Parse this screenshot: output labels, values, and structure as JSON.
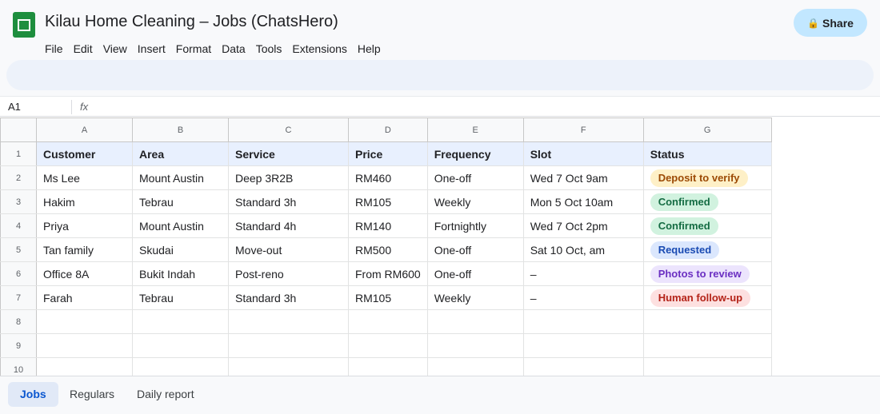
{
  "app": {
    "title": "Kilau Home Cleaning – Jobs (ChatsHero)",
    "share_label": "Share",
    "share_icon": "lock-icon",
    "brand_color": "#1e8e3e"
  },
  "menu": [
    "File",
    "Edit",
    "View",
    "Insert",
    "Format",
    "Data",
    "Tools",
    "Extensions",
    "Help"
  ],
  "formula_bar": {
    "cell_ref": "A1",
    "fx_label": "fx",
    "value": ""
  },
  "grid": {
    "column_letters": [
      "A",
      "B",
      "C",
      "D",
      "E",
      "F",
      "G"
    ],
    "row_numbers": [
      "1",
      "2",
      "3",
      "4",
      "5",
      "6",
      "7",
      "8",
      "9",
      "10"
    ],
    "headers": [
      "Customer",
      "Area",
      "Service",
      "Price",
      "Frequency",
      "Slot",
      "Status"
    ],
    "rows": [
      [
        "Ms Lee",
        "Mount Austin",
        "Deep 3R2B",
        "RM460",
        "One-off",
        "Wed 7 Oct 9am",
        "Deposit to verify"
      ],
      [
        "Hakim",
        "Tebrau",
        "Standard 3h",
        "RM105",
        "Weekly",
        "Mon 5 Oct 10am",
        "Confirmed"
      ],
      [
        "Priya",
        "Mount Austin",
        "Standard 4h",
        "RM140",
        "Fortnightly",
        "Wed 7 Oct 2pm",
        "Confirmed"
      ],
      [
        "Tan family",
        "Skudai",
        "Move-out",
        "RM500",
        "One-off",
        "Sat 10 Oct, am",
        "Requested"
      ],
      [
        "Office 8A",
        "Bukit Indah",
        "Post-reno",
        "From RM600",
        "One-off",
        "–",
        "Photos to review"
      ],
      [
        "Farah",
        "Tebrau",
        "Standard 3h",
        "RM105",
        "Weekly",
        "–",
        "Human follow-up"
      ]
    ],
    "status_styles": [
      "deposit",
      "confirmed",
      "confirmed",
      "requested",
      "photos",
      "human"
    ]
  },
  "sheets": [
    {
      "label": "Jobs",
      "active": true
    },
    {
      "label": "Regulars",
      "active": false
    },
    {
      "label": "Daily report",
      "active": false
    }
  ]
}
